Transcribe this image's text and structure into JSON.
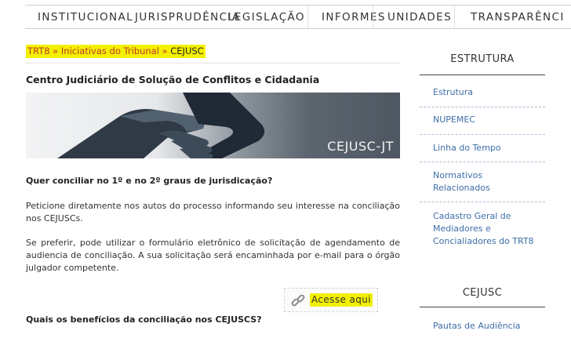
{
  "nav": {
    "items": [
      "INSTITUCIONAL",
      "JURISPRUDÊNCIA",
      "LEGISLAÇÃO",
      "INFORMES",
      "UNIDADES",
      "TRANSPARÊNCI"
    ]
  },
  "breadcrumb": {
    "items": [
      "TRT8",
      "Iniciativas do Tribunal",
      "CEJUSC"
    ],
    "separator": " » "
  },
  "main": {
    "title": "Centro Judiciário de Solução de Conflitos e Cidadania",
    "banner_label": "CEJUSC-JT",
    "question1": "Quer conciliar no 1º e no 2º graus de jurisdicação?",
    "paragraph1": "Peticione diretamente nos autos do processo informando seu interesse na conciliação nos CEJUSCs.",
    "paragraph2": "Se preferir, pode utilizar o formulário eletrônico de solicitação de agendamento de audiencia de conciliação. A sua solicitação será encaminhada por e-mail para o órgão julgador competente.",
    "acesse_label": "Acesse aqui",
    "question2": "Quais os benefícios da conciliação nos CEJUSCS?"
  },
  "sidebar": {
    "estrutura_title": "ESTRUTURA",
    "items": [
      "Estrutura",
      "NUPEMEC",
      "Linha do Tempo",
      "Normativos Relacionados",
      "Cadastro Geral de Mediadores e Concialiadores do TRT8"
    ],
    "cejusc_title": "CEJUSC",
    "cejusc_items": [
      "Pautas de Audiência"
    ]
  },
  "colors": {
    "highlight": "#f3f000",
    "breadcrumb_link": "#c0392b",
    "sidebar_link": "#3c6ea6"
  }
}
